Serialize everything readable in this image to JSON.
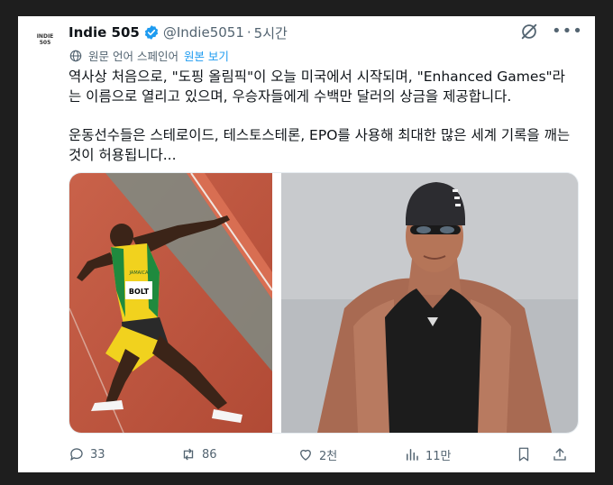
{
  "avatar": {
    "line1": "INDIE",
    "line2": "505"
  },
  "tweet": {
    "display_name": "Indie 505",
    "handle": "@Indie5051",
    "separator": "·",
    "time": "5시간",
    "translate_note": "원문 언어 스페인어",
    "view_original": "원본 보기",
    "paragraph1": "역사상 처음으로, \"도핑 올림픽\"이 오늘 미국에서 시작되며, \"Enhanced Games\"라는 이름으로 열리고 있으며, 우승자들에게 수백만 달러의 상금을 제공합니다.",
    "paragraph2": "운동선수들은 스테로이드, 테스토스테론, EPO를 사용해 최대한 많은 세계 기록을 깨는 것이 허용됩니다..."
  },
  "media": {
    "left_bib": "BOLT",
    "left_bib_brand": "JAMAICA"
  },
  "actions": {
    "replies": "33",
    "reposts": "86",
    "likes": "2천",
    "views": "11만"
  },
  "colors": {
    "accent": "#1d9bf0",
    "muted": "#536471",
    "text": "#0f1419"
  },
  "icons": [
    "verified-badge-icon",
    "grok-icon",
    "more-icon",
    "globe-icon",
    "reply-icon",
    "repost-icon",
    "like-icon",
    "views-icon",
    "bookmark-icon",
    "share-icon"
  ]
}
